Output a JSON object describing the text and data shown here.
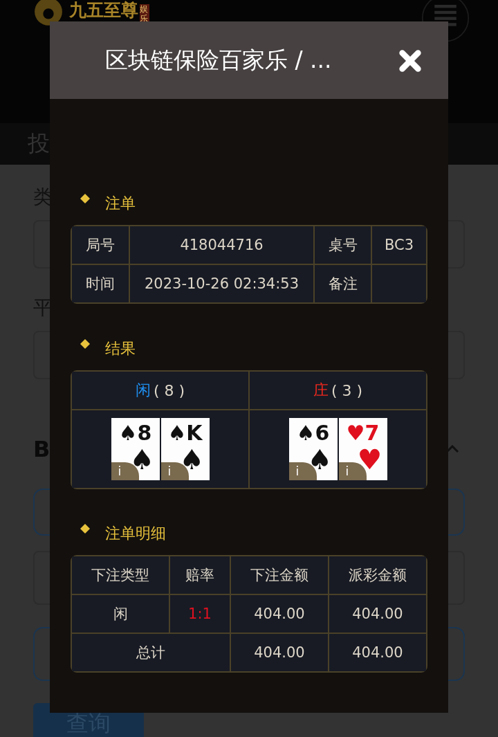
{
  "background": {
    "logo": {
      "name": "九五至尊",
      "badge": "娱乐"
    },
    "tab": "投",
    "labels": [
      "类",
      "平"
    ],
    "section": "B",
    "button": "查询"
  },
  "dialog": {
    "title": "区块链保险百家乐 / ...",
    "order": {
      "title": "注单",
      "rows": [
        [
          "局号",
          "418044716",
          "桌号",
          "BC3"
        ],
        [
          "时间",
          "2023-10-26 02:34:53",
          "备注"
        ]
      ]
    },
    "result": {
      "title": "结果",
      "sides": [
        {
          "name": "闲",
          "kind": "player",
          "score": "( 8 )",
          "cards": [
            {
              "rank": "8",
              "suit": "♠",
              "color": "#111111",
              "info": "i"
            },
            {
              "rank": "K",
              "suit": "♠",
              "color": "#111111",
              "info": "i"
            }
          ]
        },
        {
          "name": "庄",
          "kind": "banker",
          "score": "( 3 )",
          "cards": [
            {
              "rank": "6",
              "suit": "♠",
              "color": "#111111",
              "info": "i"
            },
            {
              "rank": "7",
              "suit": "♥",
              "color": "#e0101e",
              "info": "i"
            }
          ]
        }
      ]
    },
    "details": {
      "title": "注单明细",
      "columns": [
        "下注类型",
        "赔率",
        "下注金额",
        "派彩金额"
      ],
      "rows": [
        {
          "type": "闲",
          "odds": "1:1",
          "stake": "404.00",
          "payout": "404.00"
        }
      ],
      "total": {
        "label": "总计",
        "stake": "404.00",
        "payout": "404.00"
      }
    }
  }
}
